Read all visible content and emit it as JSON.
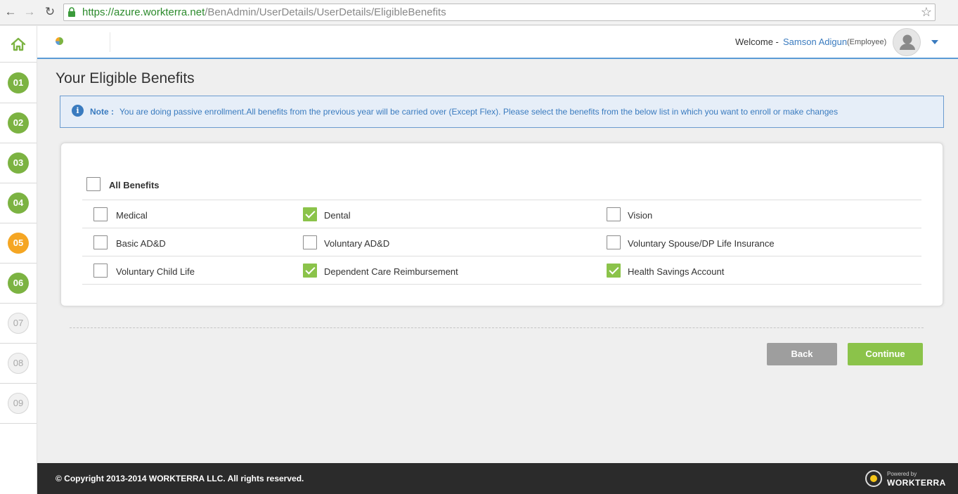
{
  "browser": {
    "url_host": "https://azure.workterra.net",
    "url_path": "/BenAdmin/UserDetails/UserDetails/EligibleBenefits"
  },
  "rail": {
    "steps": [
      {
        "label": "01",
        "state": "done"
      },
      {
        "label": "02",
        "state": "done"
      },
      {
        "label": "03",
        "state": "done"
      },
      {
        "label": "04",
        "state": "done"
      },
      {
        "label": "05",
        "state": "current"
      },
      {
        "label": "06",
        "state": "done"
      },
      {
        "label": "07",
        "state": "todo"
      },
      {
        "label": "08",
        "state": "todo"
      },
      {
        "label": "09",
        "state": "todo"
      }
    ]
  },
  "header": {
    "welcome": "Welcome -",
    "user_name": "Samson Adigun",
    "user_role": "(Employee)"
  },
  "main": {
    "title": "Your Eligible Benefits",
    "note_label": "Note :",
    "note_text": "You are doing passive enrollment.All benefits from the previous year will be carried over (Except Flex). Please select the benefits from the below list in which you want to enroll or make changes"
  },
  "benefits": {
    "all_label": "All Benefits",
    "all_checked": false,
    "items": [
      {
        "label": "Medical",
        "checked": false
      },
      {
        "label": "Dental",
        "checked": true
      },
      {
        "label": "Vision",
        "checked": false
      },
      {
        "label": "Basic AD&D",
        "checked": false
      },
      {
        "label": "Voluntary AD&D",
        "checked": false
      },
      {
        "label": "Voluntary Spouse/DP Life Insurance",
        "checked": false
      },
      {
        "label": "Voluntary Child Life",
        "checked": false
      },
      {
        "label": "Dependent Care Reimbursement",
        "checked": true
      },
      {
        "label": "Health Savings Account",
        "checked": true
      }
    ]
  },
  "actions": {
    "back_label": "Back",
    "continue_label": "Continue"
  },
  "footer": {
    "copyright": "© Copyright 2013-2014 WORKTERRA LLC. All rights reserved.",
    "powered_by": "Powered by",
    "brand": "WORKTERRA"
  },
  "colors": {
    "accent_green": "#8bc34a",
    "step_done": "#7cb342",
    "step_current": "#f5a623",
    "link_blue": "#3a7bbf"
  }
}
